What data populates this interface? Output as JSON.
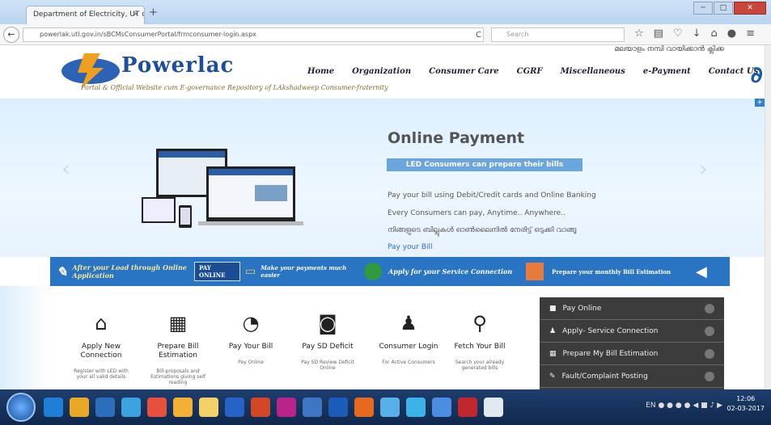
{
  "browser": {
    "tab_title": "Department of Electricity, UT o...",
    "tab_close": "×",
    "new_tab": "+",
    "url": "powerlak.utl.gov.in/sBCMsConsumerPortal/frmconsumer-login.aspx",
    "search_placeholder": "Search",
    "back": "←",
    "reload": "C"
  },
  "site": {
    "malayalam_link": "മലയാളം നമ്പി വായിക്കാൻ ക്ലിക്ക",
    "logo_text": "Powerlac",
    "tagline": "Portal & Official Website cum E-governance Repository of LAkshadweep Consumer-fraternity",
    "menu": [
      "Home",
      "Organization",
      "Consumer Care",
      "CGRF",
      "Miscellaneous",
      "e-Payment",
      "Contact Us"
    ]
  },
  "hero": {
    "title": "Online Payment",
    "ribbon": "LED Consumers can prepare their bills",
    "line1": "Pay your bill using Debit/Credit cards and Online Banking",
    "line2": "Every Consumers can pay, Anytime.. Anywhere..",
    "line3": "നിങ്ങളുടെ ബില്ലുകൾ ഓൺലൈനിൽ നേരിട്ട് ഒടുക്കി വാങ്ങൂ",
    "link": "Pay your Bill"
  },
  "banner": {
    "item1": "After your Load through Online Application",
    "item2_button": "PAY ONLINE",
    "item2_text": "Make your payments much easier",
    "item3": "Apply for your Service Connection",
    "item4": "Prepare your monthly Bill Estimation"
  },
  "cards": [
    {
      "title": "Apply New Connection",
      "desc": "Register with LED with your all valid details"
    },
    {
      "title": "Prepare Bill Estimation",
      "desc": "Bill-proposals and Estimations giving self reading"
    },
    {
      "title": "Pay Your Bill",
      "desc": "Pay Online"
    },
    {
      "title": "Pay SD Deficit",
      "desc": "Pay SD Review Deficit Online"
    },
    {
      "title": "Consumer Login",
      "desc": "For Active Consumers"
    },
    {
      "title": "Fetch Your Bill",
      "desc": "Search your already generated bills"
    }
  ],
  "sidebar": [
    "Pay Online",
    "Apply- Service Connection",
    "Prepare My Bill Estimation",
    "Fault/Complaint Posting"
  ],
  "taskbar": {
    "time": "12:06",
    "date": "02-03-2017",
    "lang": "EN"
  }
}
